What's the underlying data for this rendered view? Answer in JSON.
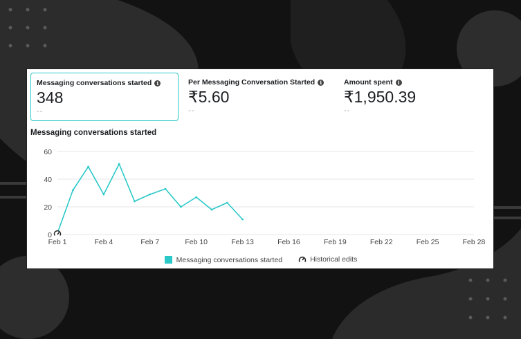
{
  "metrics": [
    {
      "label": "Messaging conversations started",
      "value": "348",
      "compare": "--",
      "selected": true
    },
    {
      "label": "Per Messaging Conversation Started",
      "value": "₹5.60",
      "compare": "--",
      "selected": false
    },
    {
      "label": "Amount spent",
      "value": "₹1,950.39",
      "compare": "--",
      "selected": false
    }
  ],
  "chart": {
    "title": "Messaging conversations started",
    "legend": {
      "series": "Messaging conversations started",
      "edits": "Historical edits"
    }
  },
  "chart_data": {
    "type": "line",
    "title": "Messaging conversations started",
    "x_ticks": [
      "Feb 1",
      "Feb 4",
      "Feb 7",
      "Feb 10",
      "Feb 13",
      "Feb 16",
      "Feb 19",
      "Feb 22",
      "Feb 25",
      "Feb 28"
    ],
    "y_ticks": [
      0,
      20,
      40,
      60
    ],
    "ylim": [
      0,
      60
    ],
    "xlim": [
      1,
      28
    ],
    "grid": true,
    "legend_position": "bottom",
    "series": [
      {
        "name": "Messaging conversations started",
        "color": "#2bc8c8",
        "x": [
          1,
          2,
          3,
          4,
          5,
          6,
          7,
          8,
          9,
          10,
          11,
          12,
          13
        ],
        "values": [
          1,
          32,
          49,
          29,
          51,
          24,
          29,
          33,
          20,
          27,
          18,
          23,
          11
        ]
      }
    ],
    "historical_edits": [
      1
    ]
  },
  "colors": {
    "accent": "#2bc8c8",
    "grid": "#e4e6eb",
    "text": "#1c1e21",
    "axis_text": "#444444"
  }
}
